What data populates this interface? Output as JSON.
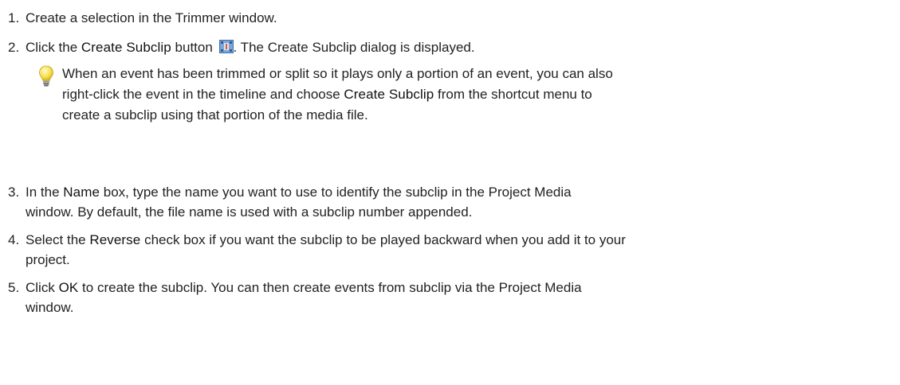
{
  "steps": [
    {
      "number": "1.",
      "text": "Create a selection in the Trimmer window."
    },
    {
      "number": "2.",
      "pre": "Click the ",
      "ui": "Create Subclip",
      "mid": " button ",
      "post": ". The Create Subclip dialog is displayed.",
      "icon": "create-subclip-icon"
    },
    {
      "number": "3.",
      "pre": "In the ",
      "ui": "Name",
      "post": " box, type the name you want to use to identify the subclip in the Project Media",
      "line2": "window. By default, the file name is used with a subclip number appended."
    },
    {
      "number": "4.",
      "pre": "Select the ",
      "ui": "Reverse",
      "post": " check box if you want the subclip to be played backward when you add it to your",
      "line2": " project."
    },
    {
      "number": "5.",
      "pre": "Click ",
      "ui": "OK",
      "post": " to create the subclip. You can then create events from subclip via the Project Media",
      "line2": "window."
    }
  ],
  "tip": {
    "icon": "lightbulb-icon",
    "line1": "When an event has been trimmed or split so it plays only a portion of an event, you can also",
    "line2_pre": "right-click the event in the timeline and choose ",
    "line2_ui": "Create Subclip",
    "line2_post": " from the shortcut menu to",
    "line3": "create a subclip using that portion of the media file."
  }
}
